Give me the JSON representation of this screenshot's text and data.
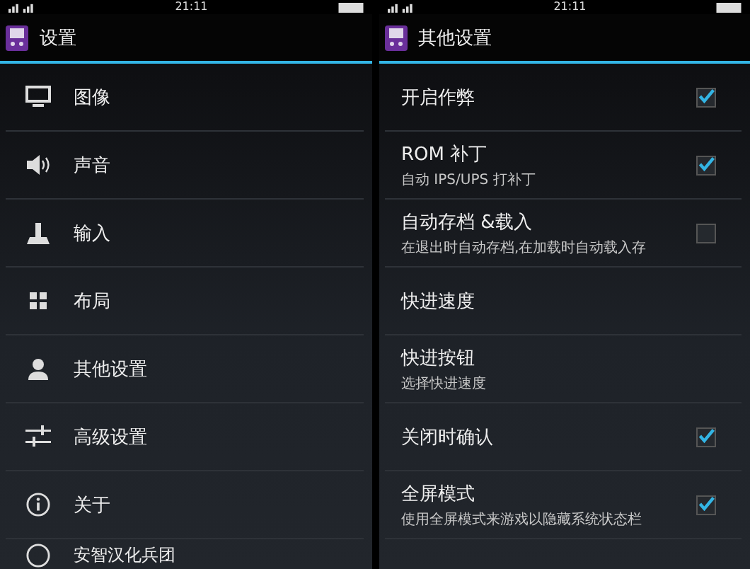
{
  "screens": [
    {
      "status_bar": {
        "time": "21:11"
      },
      "title": "设置",
      "items": [
        {
          "kind": "display",
          "label": "图像"
        },
        {
          "kind": "speaker",
          "label": "声音"
        },
        {
          "kind": "joystick",
          "label": "输入"
        },
        {
          "kind": "grid",
          "label": "布局"
        },
        {
          "kind": "person",
          "label": "其他设置"
        },
        {
          "kind": "sliders",
          "label": "高级设置"
        },
        {
          "kind": "info",
          "label": "关于"
        },
        {
          "kind": "circle",
          "label": "安智汉化兵团"
        }
      ]
    },
    {
      "status_bar": {
        "time": "21:11"
      },
      "title": "其他设置",
      "items": [
        {
          "kind": "checkbox",
          "label": "开启作弊",
          "checked": true
        },
        {
          "kind": "checkbox",
          "label": "ROM 补丁",
          "summary": "自动 IPS/UPS 打补丁",
          "checked": true
        },
        {
          "kind": "checkbox",
          "label": "自动存档 &载入",
          "summary": "在退出时自动存档,在加载时自动载入存",
          "checked": false
        },
        {
          "kind": "plain",
          "label": "快进速度"
        },
        {
          "kind": "plain",
          "label": "快进按钮",
          "summary": "选择快进速度"
        },
        {
          "kind": "checkbox",
          "label": "关闭时确认",
          "checked": true
        },
        {
          "kind": "checkbox",
          "label": "全屏模式",
          "summary": "使用全屏模式来游戏以隐藏系统状态栏",
          "checked": true
        }
      ]
    }
  ]
}
